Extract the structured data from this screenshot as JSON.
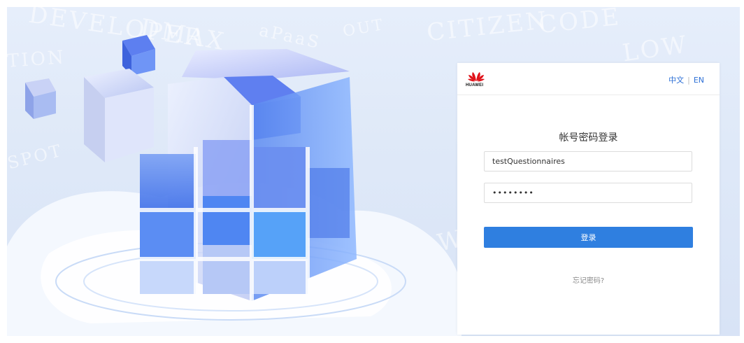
{
  "brand": {
    "name": "HUAWEI",
    "logo_icon": "huawei-petal-icon",
    "logo_color": "#e0131a"
  },
  "header": {
    "lang_zh": "中文",
    "lang_sep": "|",
    "lang_en": "EN",
    "link_color": "#2c6fd6"
  },
  "login": {
    "title": "帐号密码登录",
    "username_value": "testQuestionnaires",
    "password_value": "••••••••",
    "submit_label": "登录",
    "forgot_label": "忘记密码?",
    "button_color": "#2f7fe0"
  }
}
